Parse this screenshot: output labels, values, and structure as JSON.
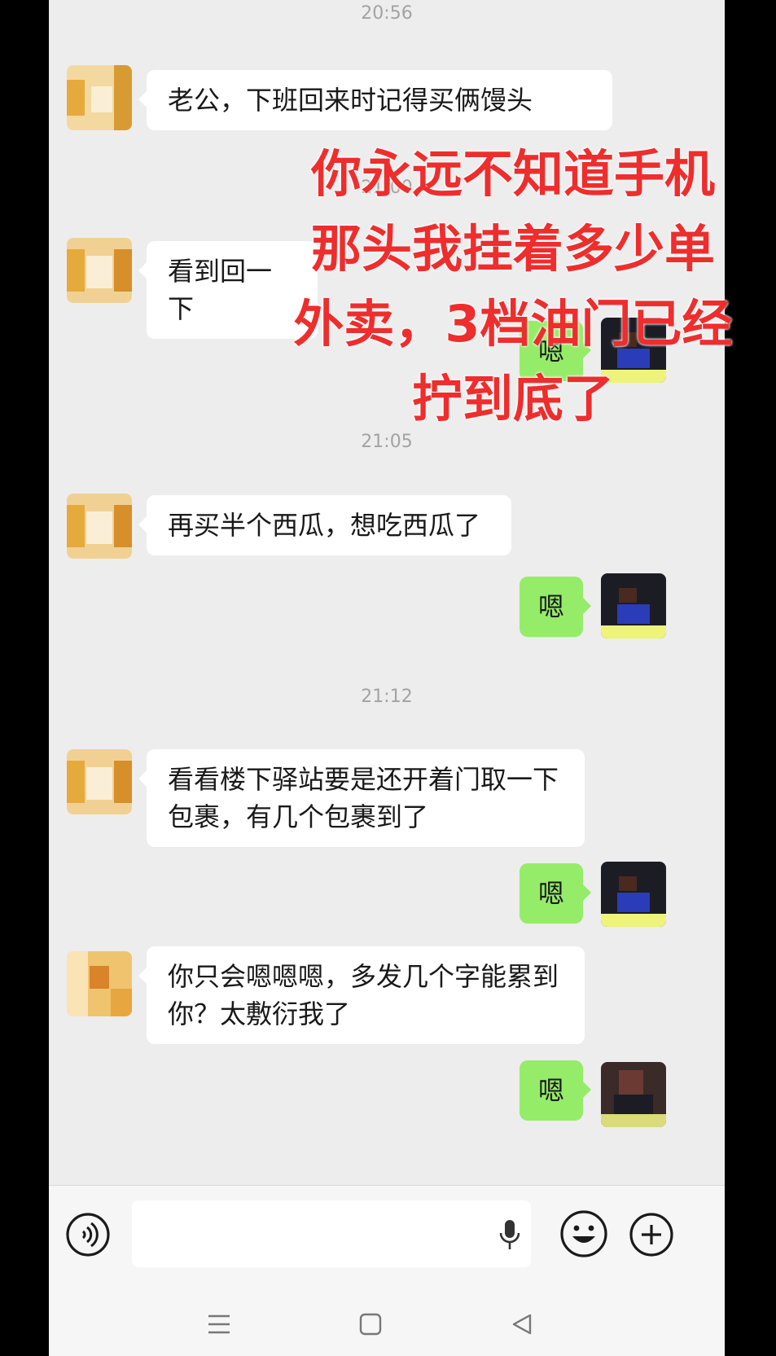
{
  "timestamps": [
    "20:56",
    "21:00",
    "21:05",
    "21:12"
  ],
  "messages": [
    {
      "side": "left",
      "text": "老公，下班回来时记得买俩馒头"
    },
    {
      "side": "left",
      "text": "看到回一下"
    },
    {
      "side": "right",
      "text": "嗯"
    },
    {
      "side": "left",
      "text": "再买半个西瓜，想吃西瓜了"
    },
    {
      "side": "right",
      "text": "嗯"
    },
    {
      "side": "left",
      "text": "看看楼下驿站要是还开着门取一下包裹，有几个包裹到了"
    },
    {
      "side": "right",
      "text": "嗯"
    },
    {
      "side": "left",
      "text": "你只会嗯嗯嗯，多发几个字能累到你？太敷衍我了"
    },
    {
      "side": "right",
      "text": "嗯"
    }
  ],
  "overlay_caption": "你永远不知道手机\n那头我挂着多少单\n外卖，3档油门已经\n拧到底了",
  "input_bar": {
    "icons": [
      "voice-icon",
      "microphone-icon",
      "emoji-icon",
      "plus-icon"
    ]
  },
  "nav_bar": {
    "icons": [
      "menu-icon",
      "home-icon",
      "back-icon"
    ]
  },
  "colors": {
    "background": "#ededed",
    "sent_bubble": "#95ec69",
    "received_bubble": "#ffffff",
    "overlay_text": "#ee2d2d"
  }
}
